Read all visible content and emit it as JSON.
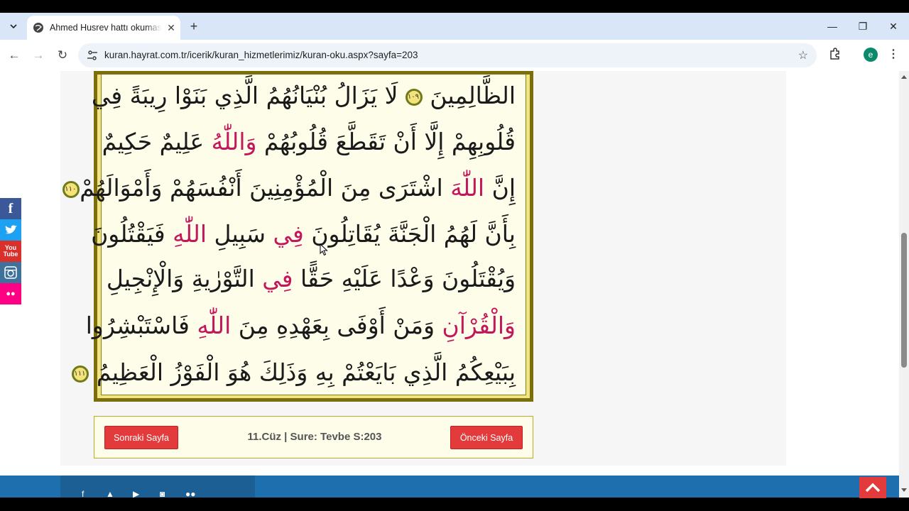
{
  "browser": {
    "tab_title": "Ahmed Husrev hattı okuması çe",
    "tab_close": "✕",
    "new_tab": "+",
    "url": "kuran.hayrat.com.tr/icerik/kuran_hizmetlerimiz/kuran-oku.aspx?sayfa=203",
    "profile_initial": "e",
    "minimize": "—",
    "restore": "❐",
    "close": "✕"
  },
  "mushaf": {
    "lines": [
      {
        "segments": [
          {
            "t": "الظَّالِمِينَ "
          },
          {
            "mark": "١٠٩"
          },
          {
            "t": " لَا يَزَالُ بُنْيَانُهُمُ الَّذِي بَنَوْا رِيبَةً فِي"
          }
        ]
      },
      {
        "segments": [
          {
            "t": "قُلُوبِهِمْ إِلَّا أَنْ تَقَطَّعَ قُلُوبُهُمْ "
          },
          {
            "r": "وَاللّٰهُ"
          },
          {
            "t": " عَلِيمٌ حَكِيمٌ"
          }
        ]
      },
      {
        "segments": [
          {
            "t": "إِنَّ "
          },
          {
            "r": "اللّٰهَ"
          },
          {
            "t": " اشْتَرَى مِنَ الْمُؤْمِنِينَ أَنْفُسَهُمْ وَأَمْوَالَهُمْ"
          }
        ],
        "lead_mark": "١١٠"
      },
      {
        "segments": [
          {
            "t": "بِأَنَّ لَهُمُ الْجَنَّةَ يُقَاتِلُونَ "
          },
          {
            "r": "فِي"
          },
          {
            "t": " سَبِيلِ "
          },
          {
            "r": "اللّٰهِ"
          },
          {
            "t": " فَيَقْتُلُونَ"
          }
        ]
      },
      {
        "segments": [
          {
            "t": "وَيُقْتَلُونَ وَعْدًا عَلَيْهِ حَقًّا "
          },
          {
            "r": "فِي"
          },
          {
            "t": " التَّوْرٰيةِ وَالْإِنْجِيلِ"
          }
        ]
      },
      {
        "segments": [
          {
            "r": "وَالْقُرْآنِ"
          },
          {
            "t": " وَمَنْ أَوْفَى بِعَهْدِهِ مِنَ "
          },
          {
            "r": "اللّٰهِ"
          },
          {
            "t": " فَاسْتَبْشِرُوا"
          }
        ]
      },
      {
        "segments": [
          {
            "t": "بِبَيْعِكُمُ الَّذِي بَايَعْتُمْ بِهِ وَذَلِكَ هُوَ الْفَوْزُ الْعَظِيمُ "
          },
          {
            "mark": "١١١"
          }
        ]
      }
    ]
  },
  "pager": {
    "next_label": "Sonraki Sayfa",
    "info": "11.Cüz | Sure: Tevbe  S:203",
    "prev_label": "Önceki Sayfa"
  },
  "social": [
    {
      "name": "facebook",
      "glyph": "f",
      "color": "#3b5998"
    },
    {
      "name": "twitter",
      "glyph": "🐦",
      "color": "#1da1f2"
    },
    {
      "name": "youtube",
      "glyph": "You\nTube",
      "color": "#d9302c"
    },
    {
      "name": "instagram",
      "glyph": "◙",
      "color": "#3f729b"
    },
    {
      "name": "flickr",
      "glyph": "●●",
      "color": "#ff0084"
    }
  ],
  "colors": {
    "accent_red": "#e33b3b",
    "frame": "#7c6e0b",
    "footer": "#1e6fae"
  }
}
